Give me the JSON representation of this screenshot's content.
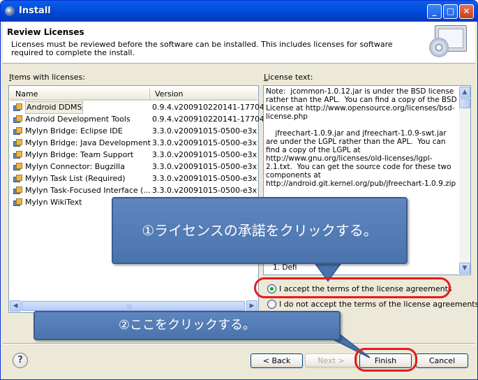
{
  "window": {
    "title": "Install"
  },
  "header": {
    "title": "Review Licenses",
    "description": "Licenses must be reviewed before the software can be installed.  This includes licenses for software required to complete the install."
  },
  "left_panel": {
    "label_accel": "I",
    "label_rest": "tems with licenses:",
    "columns": [
      "Name",
      "Version"
    ],
    "rows": [
      {
        "name": "Android DDMS",
        "version": "0.9.4.v200910220141-17704",
        "selected": true
      },
      {
        "name": "Android Development Tools",
        "version": "0.9.4.v200910220141-17704"
      },
      {
        "name": "Mylyn Bridge: Eclipse IDE",
        "version": "3.3.0.v20091015-0500-e3x"
      },
      {
        "name": "Mylyn Bridge: Java Development",
        "version": "3.3.0.v20091015-0500-e3x"
      },
      {
        "name": "Mylyn Bridge: Team Support",
        "version": "3.3.0.v20091015-0500-e3x"
      },
      {
        "name": "Mylyn Connector: Bugzilla",
        "version": "3.3.0.v20091015-0500-e3x"
      },
      {
        "name": "Mylyn Task List (Required)",
        "version": "3.3.0.v20091015-0500-e3x"
      },
      {
        "name": "Mylyn Task-Focused Interface (...",
        "version": "3.3.0.v20091015-0500-e3x"
      },
      {
        "name": "Mylyn WikiText",
        "version": ""
      }
    ]
  },
  "right_panel": {
    "label_accel": "L",
    "label_rest": "icense text:",
    "text": "Note:  jcommon-1.0.12.jar is under the BSD license rather than the APL.  You can find a copy of the BSD License at http://www.opensource.org/licenses/bsd-license.php\n\n    jfreechart-1.0.9.jar and jfreechart-1.0.9-swt.jar are under the LGPL rather than the APL.  You can find a copy of the LGPL at http://www.gnu.org/licenses/old-licenses/lgpl-2.1.txt.  You can get the source code for these two components at http://android.git.kernel.org/pub/jfreechart-1.0.9.zip\n\n\n                                                  2004\n                                                icenses/\n\n\n\n\n\n   1. Defi"
  },
  "options": {
    "accept": "I accept the terms of the license agreements",
    "decline": "I do not accept the terms of the license agreements",
    "accept_checked": true
  },
  "buttons": {
    "back": "< Back",
    "next": "Next >",
    "finish": "Finish",
    "cancel": "Cancel",
    "help": "?"
  },
  "annotations": {
    "callout_1": "①ライセンスの承諾をクリックする。",
    "callout_2": "②ここをクリックする。"
  }
}
